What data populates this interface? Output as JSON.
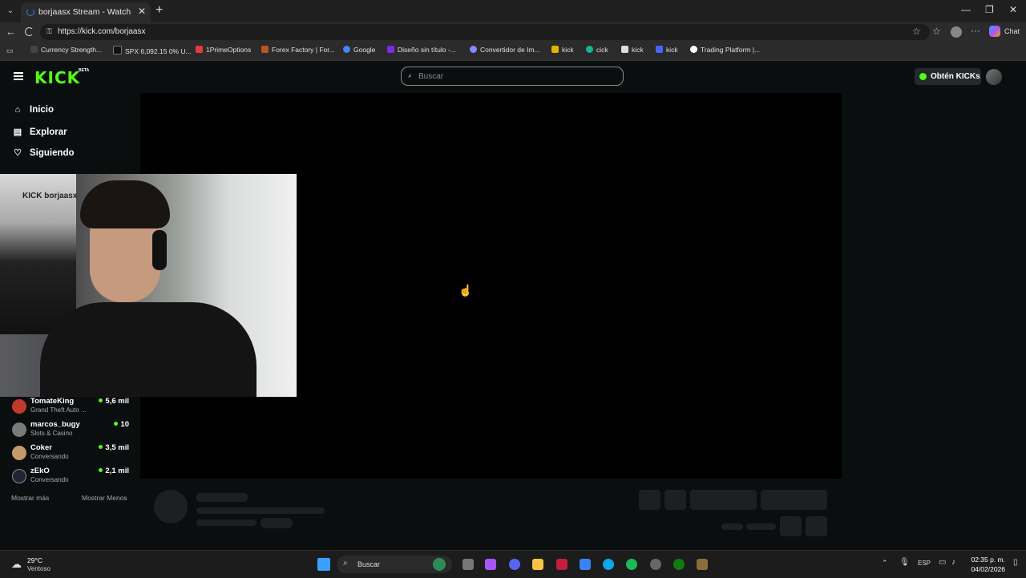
{
  "browser": {
    "tab_title": "borjaasx Stream - Watch Live on K",
    "url": "https://kick.com/borjaasx",
    "chat_label": "Chat",
    "bookmarks": [
      {
        "label": "Currency Strength...",
        "color": "#444"
      },
      {
        "label": "SPX 6,092.15 0% U...",
        "color": "#111"
      },
      {
        "label": "1PrimeOptions",
        "color": "#e23b3b"
      },
      {
        "label": "Forex Factory | For...",
        "color": "#bb5522"
      },
      {
        "label": "Google",
        "color": "#4285f4"
      },
      {
        "label": "Diseño sin título -...",
        "color": "#7d2ae8"
      },
      {
        "label": "Convertidor de Im...",
        "color": "#8888ff"
      },
      {
        "label": "kick",
        "color": "#e0b400"
      },
      {
        "label": "cick",
        "color": "#1ab394"
      },
      {
        "label": "kick",
        "color": "#d33"
      },
      {
        "label": "kick",
        "color": "#4466ff"
      },
      {
        "label": "Trading Platform |...",
        "color": "#fff"
      }
    ]
  },
  "kick": {
    "logo": "KICK",
    "logo_badge": "BETA",
    "search_placeholder": "Buscar",
    "kicks_button": "Obtén KICKs",
    "nav": [
      {
        "label": "Inicio",
        "icon": "home-icon"
      },
      {
        "label": "Explorar",
        "icon": "compass-icon"
      },
      {
        "label": "Siguiendo",
        "icon": "heart-icon"
      }
    ],
    "webcam_poster": "KICK borjaasx",
    "channels": [
      {
        "name": "TomateKing",
        "category": "Grand Theft Auto ...",
        "viewers": "5,6 mil",
        "color": "#c0392b"
      },
      {
        "name": "marcos_bugy",
        "category": "Slots & Casino",
        "viewers": "10",
        "color": "#7a7a7a"
      },
      {
        "name": "Coker",
        "category": "Conversando",
        "viewers": "3,5 mil",
        "color": "#c49a6c"
      },
      {
        "name": "zEkO",
        "category": "Conversando",
        "viewers": "2,1 mil",
        "color": "#223"
      }
    ],
    "show_more": "Mostrar más",
    "show_less": "Mostrar Menos"
  },
  "taskbar": {
    "temperature": "29°C",
    "weather": "Ventoso",
    "search": "Buscar",
    "language": "ESP",
    "time": "02:35 p. m.",
    "date": "04/02/2026"
  }
}
